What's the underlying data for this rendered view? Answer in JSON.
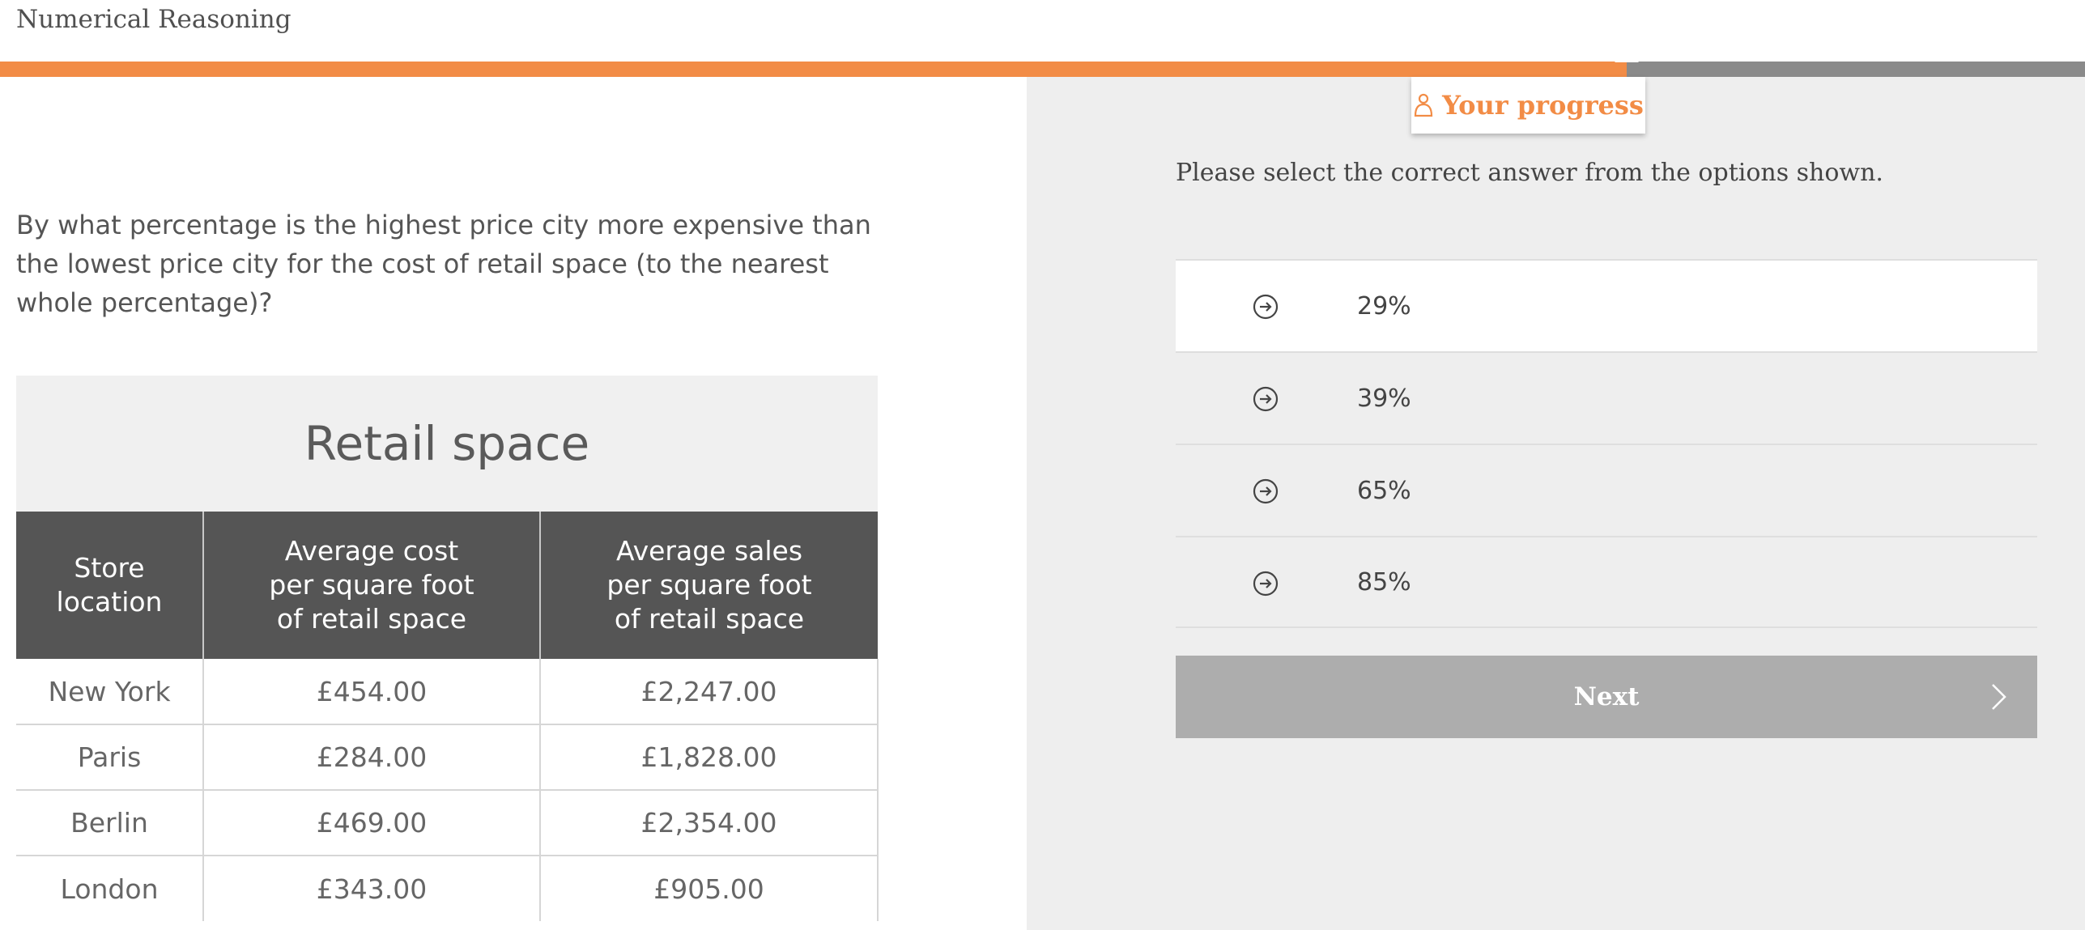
{
  "app": {
    "title": "Numerical Reasoning"
  },
  "progress": {
    "fraction": 0.78,
    "tooltip_label": "Your progress",
    "fill_color": "#f28c46",
    "track_color": "#8a8a8a"
  },
  "question": {
    "text": "By what percentage is the highest price city more expensive than the lowest price city for the cost of retail space (to the nearest whole percentage)?"
  },
  "table": {
    "title": "Retail space",
    "headers": [
      [
        "Store",
        "location"
      ],
      [
        "Average cost",
        "per square foot",
        "of retail space"
      ],
      [
        "Average sales",
        "per square foot",
        "of retail space"
      ]
    ],
    "rows": [
      [
        "New York",
        "£454.00",
        "£2,247.00"
      ],
      [
        "Paris",
        "£284.00",
        "£1,828.00"
      ],
      [
        "Berlin",
        "£469.00",
        "£2,354.00"
      ],
      [
        "London",
        "£343.00",
        "£905.00"
      ]
    ]
  },
  "answers": {
    "instruction": "Please select the correct answer from the options shown.",
    "options": [
      {
        "label": "29%",
        "icon": "arrow-circle-right-icon",
        "selected": true
      },
      {
        "label": "39%",
        "icon": "arrow-circle-right-icon",
        "selected": false
      },
      {
        "label": "65%",
        "icon": "arrow-circle-right-icon",
        "selected": false
      },
      {
        "label": "85%",
        "icon": "arrow-circle-right-icon",
        "selected": false
      }
    ]
  },
  "next": {
    "label": "Next",
    "icon": "chevron-right-icon"
  }
}
